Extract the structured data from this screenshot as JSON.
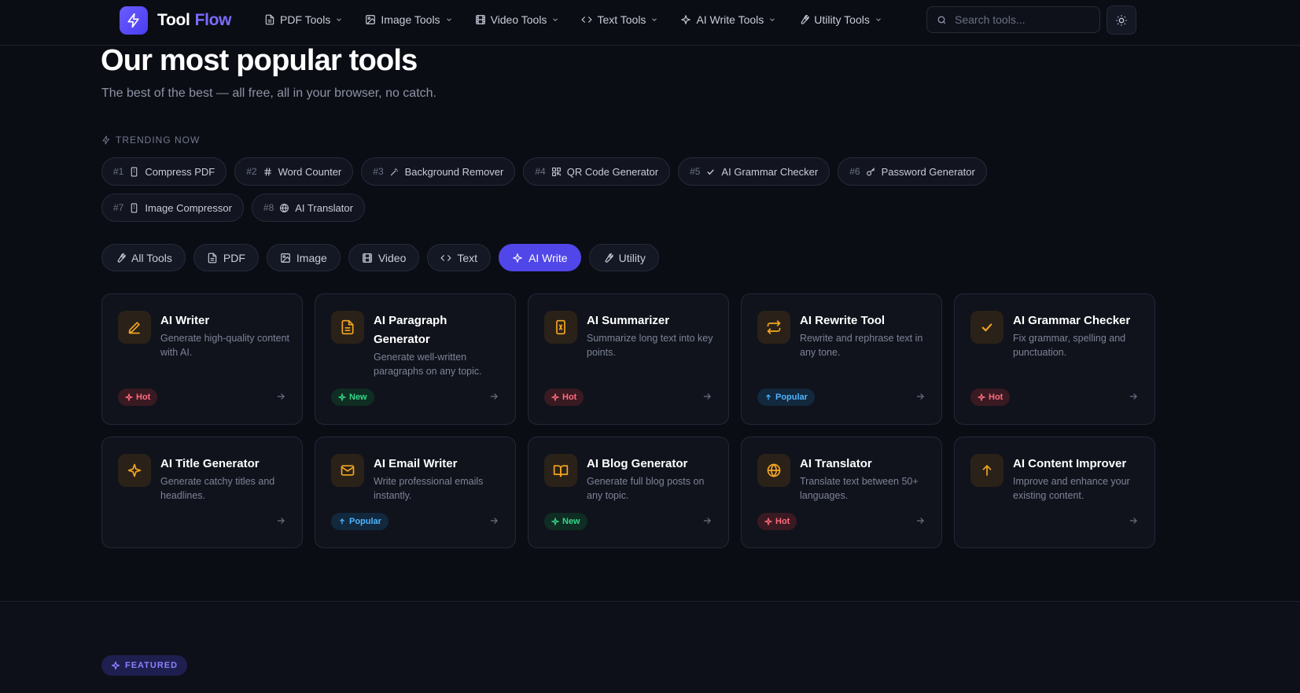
{
  "header": {
    "brand_part1": "Tool",
    "brand_part2": "Flow",
    "nav": [
      {
        "label": "PDF Tools",
        "icon": "file-icon"
      },
      {
        "label": "Image Tools",
        "icon": "image-icon"
      },
      {
        "label": "Video Tools",
        "icon": "film-icon"
      },
      {
        "label": "Text Tools",
        "icon": "code-icon"
      },
      {
        "label": "AI Write Tools",
        "icon": "sparkle-icon"
      },
      {
        "label": "Utility Tools",
        "icon": "wrench-icon"
      }
    ],
    "search_placeholder": "Search tools..."
  },
  "hero": {
    "title": "Our most popular tools",
    "subtitle": "The best of the best — all free, all in your browser, no catch."
  },
  "trending": {
    "label": "TRENDING NOW",
    "items": [
      {
        "rank": "#1",
        "name": "Compress PDF",
        "icon": "file-icon"
      },
      {
        "rank": "#2",
        "name": "Word Counter",
        "icon": "hash-icon"
      },
      {
        "rank": "#3",
        "name": "Background Remover",
        "icon": "wand-icon"
      },
      {
        "rank": "#4",
        "name": "QR Code Generator",
        "icon": "qr-icon"
      },
      {
        "rank": "#5",
        "name": "AI Grammar Checker",
        "icon": "check-icon"
      },
      {
        "rank": "#6",
        "name": "Password Generator",
        "icon": "key-icon"
      },
      {
        "rank": "#7",
        "name": "Image Compressor",
        "icon": "file-icon"
      },
      {
        "rank": "#8",
        "name": "AI Translator",
        "icon": "globe-icon"
      }
    ]
  },
  "filters": {
    "active": "AI Write",
    "items": [
      {
        "label": "All Tools",
        "icon": "wrench-icon"
      },
      {
        "label": "PDF",
        "icon": "file-icon"
      },
      {
        "label": "Image",
        "icon": "image-icon"
      },
      {
        "label": "Video",
        "icon": "film-icon"
      },
      {
        "label": "Text",
        "icon": "code-icon"
      },
      {
        "label": "AI Write",
        "icon": "sparkle-icon"
      },
      {
        "label": "Utility",
        "icon": "wrench-icon"
      }
    ]
  },
  "tools": [
    {
      "title": "AI Writer",
      "desc": "Generate high-quality content with AI.",
      "badge": "Hot",
      "icon": "pen-icon"
    },
    {
      "title": "AI Paragraph Generator",
      "desc": "Generate well-written paragraphs on any topic.",
      "badge": "New",
      "icon": "document-icon"
    },
    {
      "title": "AI Summarizer",
      "desc": "Summarize long text into key points.",
      "badge": "Hot",
      "icon": "summarize-icon"
    },
    {
      "title": "AI Rewrite Tool",
      "desc": "Rewrite and rephrase text in any tone.",
      "badge": "Popular",
      "icon": "repeat-icon"
    },
    {
      "title": "AI Grammar Checker",
      "desc": "Fix grammar, spelling and punctuation.",
      "badge": "Hot",
      "icon": "check-icon"
    },
    {
      "title": "AI Title Generator",
      "desc": "Generate catchy titles and headlines.",
      "badge": "",
      "icon": "sparkle-icon"
    },
    {
      "title": "AI Email Writer",
      "desc": "Write professional emails instantly.",
      "badge": "Popular",
      "icon": "mail-icon"
    },
    {
      "title": "AI Blog Generator",
      "desc": "Generate full blog posts on any topic.",
      "badge": "New",
      "icon": "book-icon"
    },
    {
      "title": "AI Translator",
      "desc": "Translate text between 50+ languages.",
      "badge": "Hot",
      "icon": "globe-icon"
    },
    {
      "title": "AI Content Improver",
      "desc": "Improve and enhance your existing content.",
      "badge": "",
      "icon": "arrow-up-icon"
    }
  ],
  "featured_label": "FEATURED",
  "colors": {
    "background": "#0b0d14",
    "accent": "#5146e8",
    "brand_accent": "#7b6cff",
    "icon_orange": "#f5a623",
    "hot": "#ff6b7d",
    "new": "#36d68a",
    "popular": "#4fb4ff"
  }
}
